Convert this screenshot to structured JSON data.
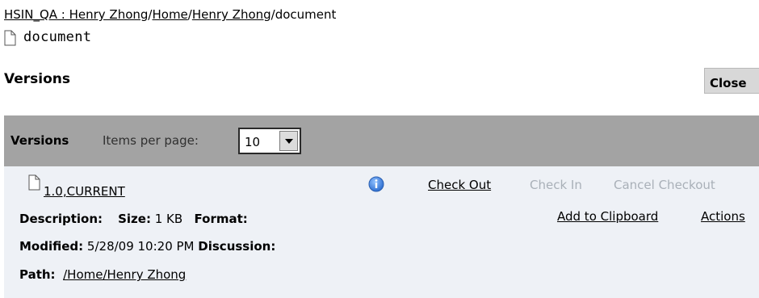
{
  "breadcrumb": {
    "root": "HSIN_QA : Henry Zhong",
    "sep": "/",
    "items": [
      "Home",
      "Henry Zhong"
    ],
    "current": "document"
  },
  "document": {
    "name": "document"
  },
  "versions_heading": "Versions",
  "close_label": "Close",
  "toolbar": {
    "label": "Versions",
    "items_per_page_label": "Items per page:",
    "items_per_page_value": "10"
  },
  "version": {
    "label": "1.0,CURRENT",
    "check_out": "Check Out",
    "check_in": "Check In",
    "cancel_checkout": "Cancel Checkout",
    "add_to_clipboard": "Add to Clipboard",
    "actions": "Actions",
    "description_label": "Description:",
    "size_label": "Size:",
    "size_value": "1 KB",
    "format_label": "Format:",
    "modified_label": "Modified:",
    "modified_value": "5/28/09 10:20 PM",
    "discussion_label": "Discussion:",
    "path_label": "Path:",
    "path_value": "/Home/Henry Zhong"
  },
  "colors": {
    "toolbar_bg": "#a3a3a3",
    "panel_bg": "#eef1f6",
    "disabled_text": "#a9b0b8",
    "info_blue": "#3a7ad6"
  },
  "icons": [
    "document-icon",
    "dropdown-arrow-icon",
    "info-icon"
  ]
}
